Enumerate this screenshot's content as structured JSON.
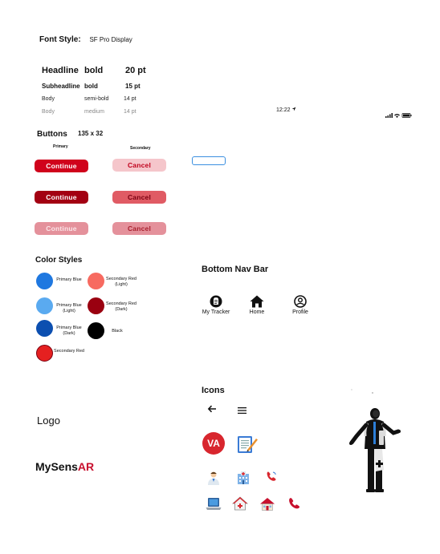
{
  "font_style": {
    "label": "Font Style:",
    "value": "SF Pro Display",
    "rows": [
      {
        "name": "Headline",
        "weight": "bold",
        "size": "20 pt"
      },
      {
        "name": "Subheadline",
        "weight": "bold",
        "size": "15 pt"
      },
      {
        "name": "Body",
        "weight": "semi-bold",
        "size": "14 pt"
      },
      {
        "name": "Body",
        "weight": "medium",
        "size": "14 pt"
      }
    ]
  },
  "status_bar": {
    "time": "12:22"
  },
  "buttons": {
    "title": "Buttons",
    "size": "135 x 32",
    "primary_header": "Primary",
    "secondary_header": "Secondary",
    "continue_label": "Continue",
    "cancel_label": "Cancel",
    "colors": {
      "primary_default": "#d0021b",
      "primary_pressed": "#a30012",
      "primary_disabled": "#e4919b",
      "secondary_default": "#f5c6cb",
      "secondary_pressed": "#e05b64",
      "secondary_disabled": "#e4919b"
    }
  },
  "color_styles": {
    "title": "Color Styles",
    "swatches": [
      {
        "label": "Primary Blue",
        "color": "#1f78e0"
      },
      {
        "label": "Secondary Red (Light)",
        "color": "#f76a60"
      },
      {
        "label": "Primary Blue (Light)",
        "color": "#5aaaf0"
      },
      {
        "label": "Secondary Red (Dark)",
        "color": "#9a0010"
      },
      {
        "label": "Primary Blue (Dark)",
        "color": "#0c4fb0"
      },
      {
        "label": "Black",
        "color": "#000000"
      },
      {
        "label": "Secondary Red",
        "color": "#e52020"
      }
    ]
  },
  "bottom_nav": {
    "title": "Bottom Nav Bar",
    "items": [
      {
        "label": "My Tracker",
        "icon": "clipboard-icon"
      },
      {
        "label": "Home",
        "icon": "home-icon"
      },
      {
        "label": "Profile",
        "icon": "profile-icon"
      }
    ]
  },
  "logo": {
    "title": "Logo",
    "wordmark_prefix": "MySens",
    "wordmark_suffix": "AR",
    "accent": "#c8102e"
  },
  "icons": {
    "title": "Icons",
    "va_badge": "VA",
    "va_color": "#d8262e"
  }
}
